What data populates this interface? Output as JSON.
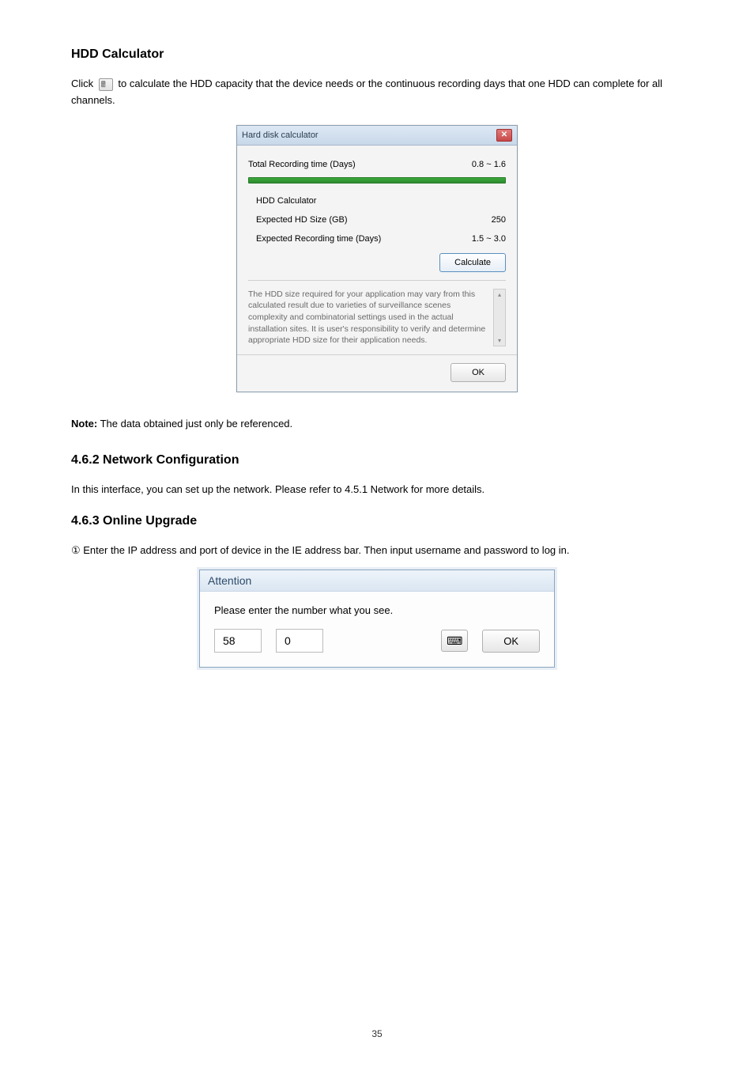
{
  "heading": "HDD Calculator",
  "intro_part1": "Click ",
  "intro_part2": " to calculate the HDD capacity that the device needs or the continuous recording days that one HDD can complete for all channels.",
  "hdd_dialog": {
    "title": "Hard disk calculator",
    "close_label": "✕",
    "total_label": "Total Recording time (Days)",
    "total_value": "0.8 ~ 1.6",
    "calc_heading": "HDD Calculator",
    "expected_hd_label": "Expected HD Size (GB)",
    "expected_hd_value": "250",
    "expected_days_label": "Expected Recording time (Days)",
    "expected_days_value": "1.5 ~ 3.0",
    "calculate_button": "Calculate",
    "disclaimer": "The HDD size required for your application may vary from this calculated result due to varieties of surveillance scenes complexity and combinatorial settings used in the actual installation sites. It is user's responsibility to verify and determine appropriate HDD size for their application needs.",
    "scroll_up": "▴",
    "scroll_down": "▾",
    "ok_button": "OK"
  },
  "note_label": "Note:",
  "note_text": " The data obtained just only be referenced.",
  "subsection_heading": "4.6.2 Network Configuration",
  "subsection_text": "In this interface, you can set up the network. Please refer to 4.5.1 Network for more details.",
  "onscreen_heading": "4.6.3 Online Upgrade",
  "onscreen_step": "① Enter the IP address and port of device in the IE address bar. Then input username and password to log in.",
  "attention": {
    "title": "Attention",
    "prompt": "Please enter the number what you see.",
    "captcha": "58",
    "input_value": "0",
    "keyboard_icon": "⌨",
    "ok_button": "OK"
  },
  "footer_page": "35"
}
